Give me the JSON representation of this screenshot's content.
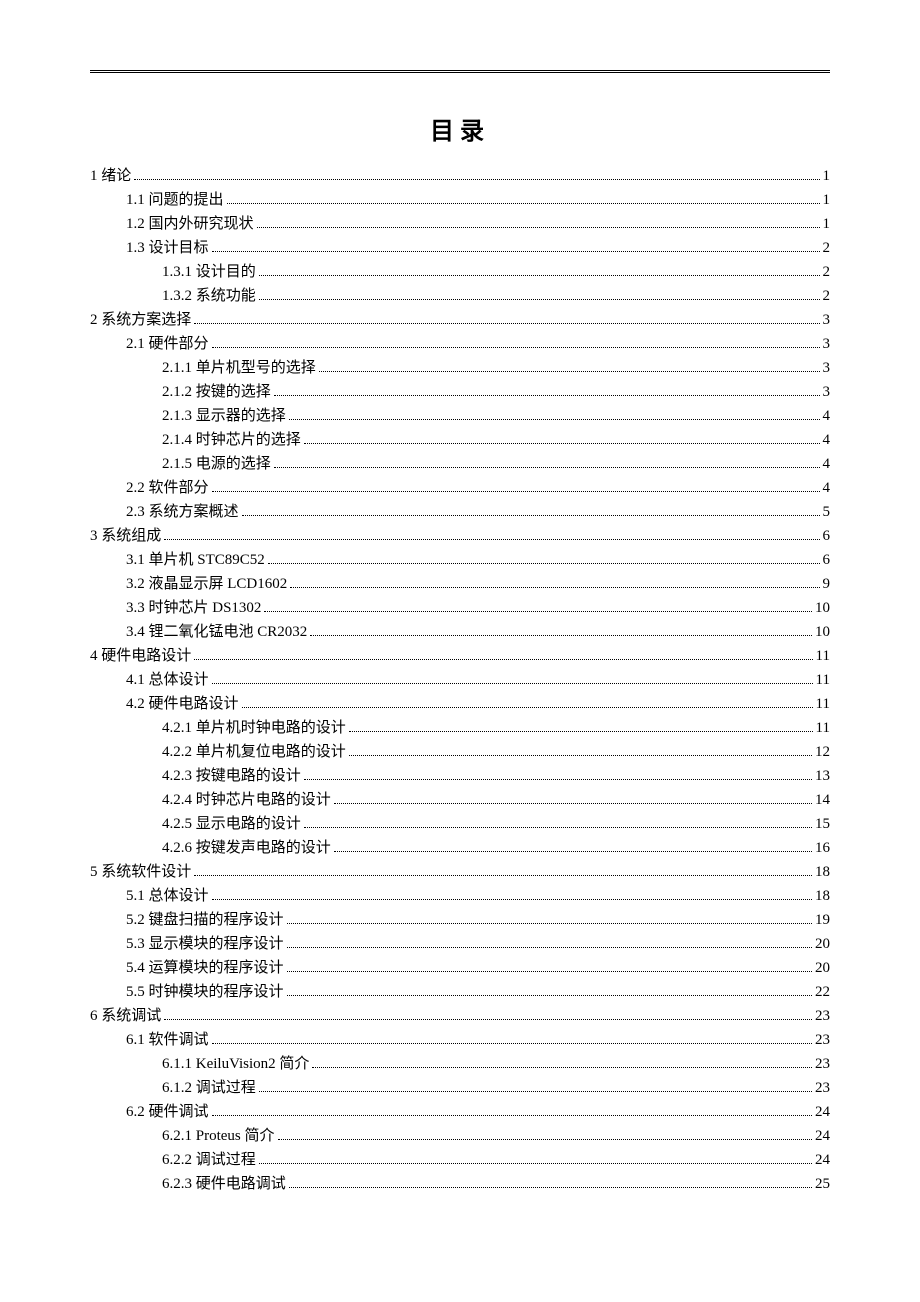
{
  "title": "目录",
  "entries": [
    {
      "level": 1,
      "label": "1 绪论",
      "page": "1"
    },
    {
      "level": 2,
      "label": "1.1 问题的提出",
      "page": "1"
    },
    {
      "level": 2,
      "label": "1.2 国内外研究现状",
      "page": "1"
    },
    {
      "level": 2,
      "label": "1.3 设计目标",
      "page": "2"
    },
    {
      "level": 3,
      "label": "1.3.1 设计目的",
      "page": "2"
    },
    {
      "level": 3,
      "label": "1.3.2 系统功能",
      "page": "2"
    },
    {
      "level": 1,
      "label": "2 系统方案选择",
      "page": "3"
    },
    {
      "level": 2,
      "label": "2.1 硬件部分",
      "page": "3"
    },
    {
      "level": 3,
      "label": "2.1.1  单片机型号的选择",
      "page": "3"
    },
    {
      "level": 3,
      "label": "2.1.2  按键的选择",
      "page": "3"
    },
    {
      "level": 3,
      "label": "2.1.3  显示器的选择",
      "page": "4"
    },
    {
      "level": 3,
      "label": "2.1.4  时钟芯片的选择",
      "page": "4"
    },
    {
      "level": 3,
      "label": "2.1.5  电源的选择",
      "page": "4"
    },
    {
      "level": 2,
      "label": "2.2 软件部分",
      "page": "4"
    },
    {
      "level": 2,
      "label": "2.3 系统方案概述",
      "page": "5"
    },
    {
      "level": 1,
      "label": "3 系统组成",
      "page": "6"
    },
    {
      "level": 2,
      "label": "3.1 单片机 STC89C52",
      "page": "6"
    },
    {
      "level": 2,
      "label": "3.2 液晶显示屏 LCD1602",
      "page": "9"
    },
    {
      "level": 2,
      "label": "3.3 时钟芯片 DS1302",
      "page": "10"
    },
    {
      "level": 2,
      "label": "3.4 锂二氧化锰电池 CR2032",
      "page": "10"
    },
    {
      "level": 1,
      "label": "4 硬件电路设计",
      "page": "11"
    },
    {
      "level": 2,
      "label": "4.1 总体设计",
      "page": "11"
    },
    {
      "level": 2,
      "label": "4.2 硬件电路设计",
      "page": "11"
    },
    {
      "level": 3,
      "label": "4.2.1 单片机时钟电路的设计",
      "page": "11"
    },
    {
      "level": 3,
      "label": "4.2.2 单片机复位电路的设计",
      "page": "12"
    },
    {
      "level": 3,
      "label": "4.2.3 按键电路的设计",
      "page": "13"
    },
    {
      "level": 3,
      "label": "4.2.4 时钟芯片电路的设计",
      "page": "14"
    },
    {
      "level": 3,
      "label": "4.2.5 显示电路的设计",
      "page": "15"
    },
    {
      "level": 3,
      "label": "4.2.6 按键发声电路的设计",
      "page": "16"
    },
    {
      "level": 1,
      "label": "5 系统软件设计",
      "page": "18"
    },
    {
      "level": 2,
      "label": "5.1  总体设计",
      "page": "18"
    },
    {
      "level": 2,
      "label": "5.2  键盘扫描的程序设计",
      "page": "19"
    },
    {
      "level": 2,
      "label": "5.3  显示模块的程序设计",
      "page": "20"
    },
    {
      "level": 2,
      "label": "5.4  运算模块的程序设计",
      "page": "20"
    },
    {
      "level": 2,
      "label": "5.5  时钟模块的程序设计",
      "page": "22"
    },
    {
      "level": 1,
      "label": "6 系统调试",
      "page": "23"
    },
    {
      "level": 2,
      "label": "6.1 软件调试",
      "page": "23"
    },
    {
      "level": 3,
      "label": "6.1.1 KeiluVision2 简介",
      "page": "23"
    },
    {
      "level": 3,
      "label": "6.1.2 调试过程",
      "page": "23"
    },
    {
      "level": 2,
      "label": "6.2 硬件调试",
      "page": "24"
    },
    {
      "level": 3,
      "label": "6.2.1 Proteus 简介",
      "page": "24"
    },
    {
      "level": 3,
      "label": "6.2.2 调试过程",
      "page": "24"
    },
    {
      "level": 3,
      "label": "6.2.3 硬件电路调试",
      "page": "25"
    }
  ]
}
